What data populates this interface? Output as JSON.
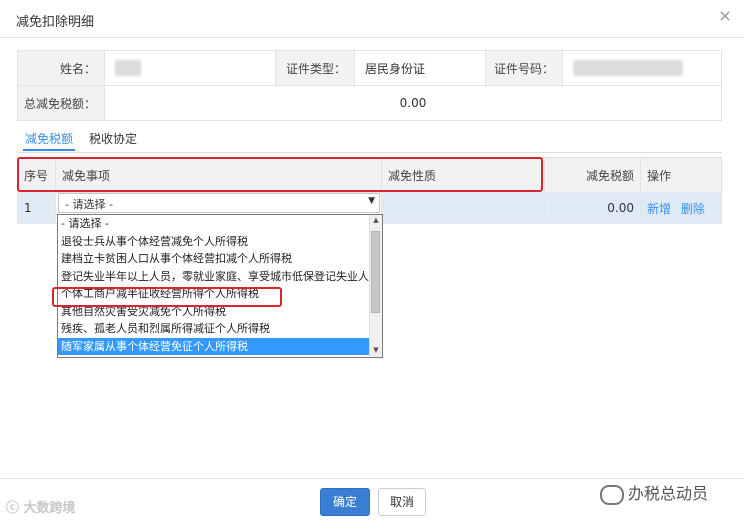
{
  "dialog": {
    "title": "减免扣除明细",
    "close_icon": "×"
  },
  "info": {
    "name_label": "姓名：",
    "idtype_label": "证件类型：",
    "idtype_value": "居民身份证",
    "idno_label": "证件号码：",
    "total_label": "总减免税额：",
    "total_value": "0.00"
  },
  "tabs": [
    "减免税额",
    "税收协定"
  ],
  "grid": {
    "headers": [
      "序号",
      "减免事项",
      "减免性质",
      "减免税额",
      "操作"
    ],
    "row": {
      "index": "1",
      "select_value": "- 请选择 -",
      "amount": "0.00",
      "add": "新增",
      "delete": "删除"
    }
  },
  "dropdown": {
    "options": [
      "- 请选择 -",
      "退役士兵从事个体经营减免个人所得税",
      "建档立卡贫困人口从事个体经营扣减个人所得税",
      "登记失业半年以上人员，零就业家庭、享受城市低保登记失业人",
      "个体工商户减半征收经营所得个人所得税",
      "其他自然灾害受灾减免个人所得税",
      "残疾、孤老人员和烈属所得减征个人所得税",
      "随军家属从事个体经营免征个人所得税"
    ],
    "highlighted_index": 7
  },
  "buttons": {
    "confirm": "确定",
    "cancel": "取消"
  },
  "watermarks": {
    "left": "大数跨境",
    "right": "办税总动员"
  },
  "colors": {
    "accent": "#3a8ee6",
    "highlight": "#3399ff",
    "annotation_red": "#d9262e"
  }
}
